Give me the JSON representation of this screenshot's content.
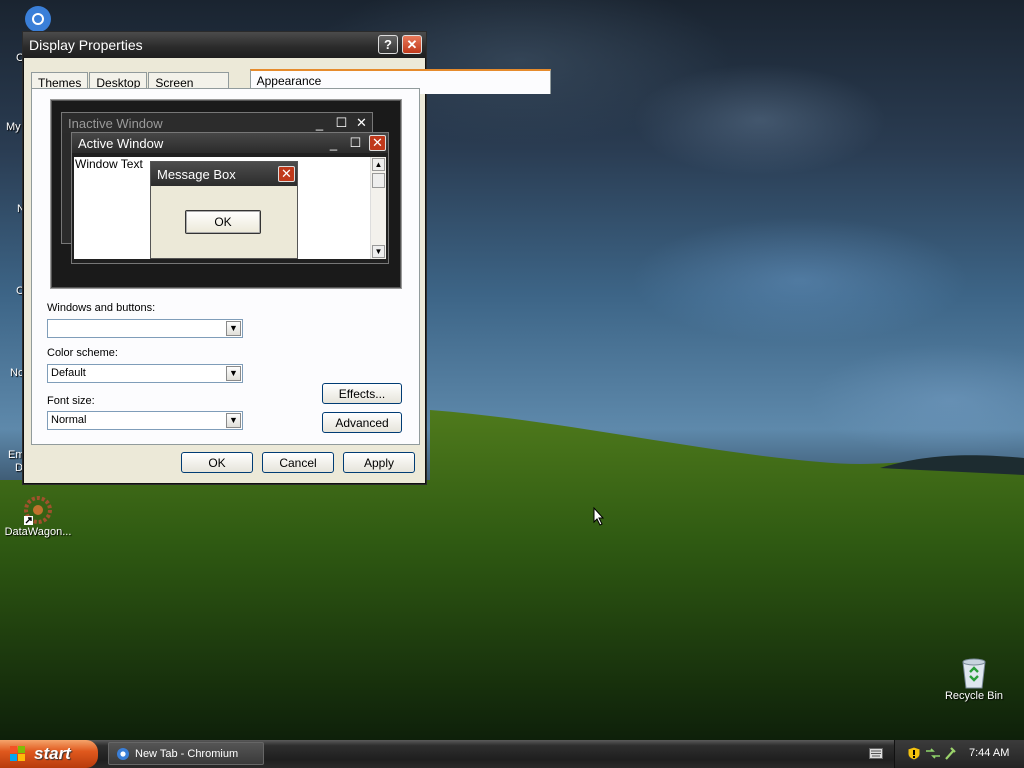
{
  "window": {
    "title": "Display Properties",
    "help_glyph": "?",
    "close_glyph": "✕",
    "tabs": [
      "Themes",
      "Desktop",
      "Screen Saver",
      "Appearance"
    ],
    "active_tab": "Appearance",
    "preview": {
      "inactive_title": "Inactive Window",
      "active_title": "Active Window",
      "window_text": "Window Text",
      "message_title": "Message Box",
      "message_ok": "OK"
    },
    "windows_buttons_label": "Windows and buttons:",
    "windows_buttons_value": "",
    "color_scheme_label": "Color scheme:",
    "color_scheme_value": "Default",
    "font_size_label": "Font size:",
    "font_size_value": "Normal",
    "effects_label": "Effects...",
    "advanced_label": "Advanced",
    "ok_label": "OK",
    "cancel_label": "Cancel",
    "apply_label": "Apply"
  },
  "desktop": {
    "partial_labels": [
      "C",
      "My",
      "N",
      "C",
      "Nc",
      "Em",
      "D"
    ],
    "datawagon_label": "DataWagon...",
    "recycle_bin_label": "Recycle Bin"
  },
  "taskbar": {
    "start_label": "start",
    "task_label": "New Tab - Chromium",
    "clock": "7:44 AM"
  },
  "colors": {
    "start_orange": "#e0591e",
    "close_red": "#c0391b",
    "tab_highlight": "#e68b2c"
  }
}
